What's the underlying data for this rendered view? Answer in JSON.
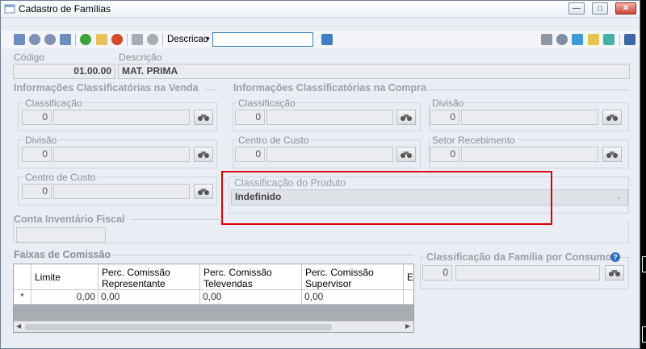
{
  "window": {
    "title": "Cadastro de Famílias",
    "minimize": "—",
    "maximize": "□",
    "close": "✕"
  },
  "toolbar": {
    "combo_label": "Descricao",
    "combo_arrow": "▾",
    "search_value": ""
  },
  "header": {
    "codigo_label": "Código",
    "codigo_value": "01.00.00",
    "descricao_label": "Descrição",
    "descricao_value": "MAT. PRIMA"
  },
  "venda": {
    "title": "Informações Classificatórias na Venda",
    "classificacao_label": "Classificação",
    "classificacao_code": "0",
    "classificacao_desc": "",
    "divisao_label": "Divisão",
    "divisao_code": "0",
    "divisao_desc": "",
    "centro_label": "Centro de Custo",
    "centro_code": "0",
    "centro_desc": ""
  },
  "compra": {
    "title": "Informações Classificatórias na Compra",
    "classificacao_label": "Classificação",
    "classificacao_code": "0",
    "divisao_label": "Divisão",
    "divisao_code": "0",
    "centro_label": "Centro de Custo",
    "centro_code": "0",
    "setor_label": "Setor Recebimento",
    "setor_code": "0"
  },
  "produto": {
    "title": "Classificação do Produto",
    "value": "Indefinido"
  },
  "inventario": {
    "title": "Conta Inventário Fiscal",
    "value": ""
  },
  "comissao": {
    "title": "Faixas de Comissão",
    "columns": [
      "Limite",
      "Perc. Comissão\nRepresentante",
      "Perc. Comissão\nTelevendas",
      "Perc. Comissão\nSupervisor",
      "E"
    ],
    "row_marker": "*",
    "row": [
      "0,00",
      "0,00",
      "0,00",
      "0,00",
      ""
    ]
  },
  "consumo": {
    "title": "Classificação da Família por Consumo",
    "code": "0",
    "help": "?"
  },
  "colors": {
    "window_bg": "#e9eef4",
    "highlight_border": "#e00000",
    "search_border": "#3c7fb1"
  }
}
